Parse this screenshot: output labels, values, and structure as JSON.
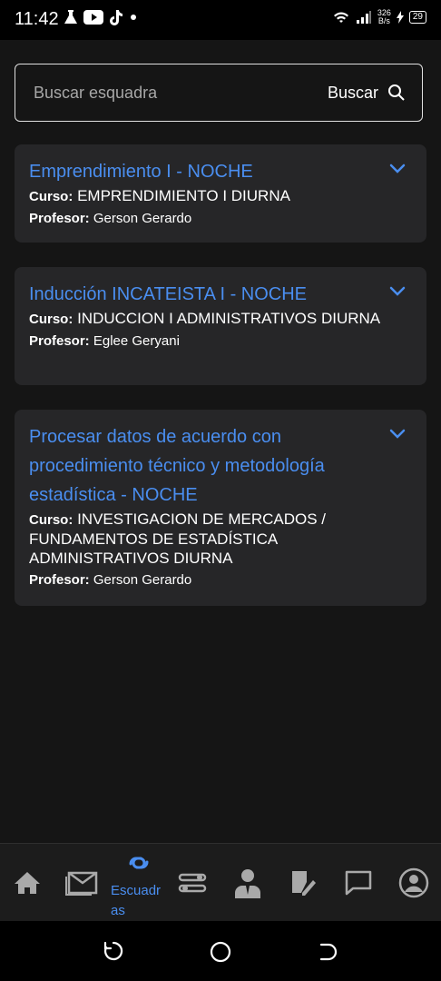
{
  "status_bar": {
    "time": "11:42",
    "net_speed_value": "326",
    "net_speed_unit": "B/s",
    "battery": "29"
  },
  "search": {
    "placeholder": "Buscar esquadra",
    "button_label": "Buscar"
  },
  "cards": [
    {
      "title": "Emprendimiento I - NOCHE",
      "course_label": "Curso:",
      "course": "EMPRENDIMIENTO I DIURNA",
      "teacher_label": "Profesor:",
      "teacher": "Gerson Gerardo"
    },
    {
      "title": "Inducción INCATEISTA I - NOCHE",
      "course_label": "Curso:",
      "course": "INDUCCION I ADMINISTRATIVOS DIURNA",
      "teacher_label": "Profesor:",
      "teacher": "Eglee Geryani"
    },
    {
      "title": "Procesar datos de acuerdo con procedimiento técnico y metodología estadística - NOCHE",
      "course_label": "Curso:",
      "course": "INVESTIGACION DE MERCADOS / FUNDAMENTOS DE ESTADÍSTICA ADMINISTRATIVOS DIURNA",
      "teacher_label": "Profesor:",
      "teacher": "Gerson Gerardo"
    }
  ],
  "bottom_nav": {
    "active_label": "Escuadras",
    "items": [
      "home-icon",
      "mail-icon",
      "squads-icon",
      "routes-icon",
      "teacher-icon",
      "grades-icon",
      "chat-icon",
      "account-icon"
    ]
  },
  "colors": {
    "accent": "#4a8ef0",
    "background": "#151515",
    "card": "#262628"
  }
}
